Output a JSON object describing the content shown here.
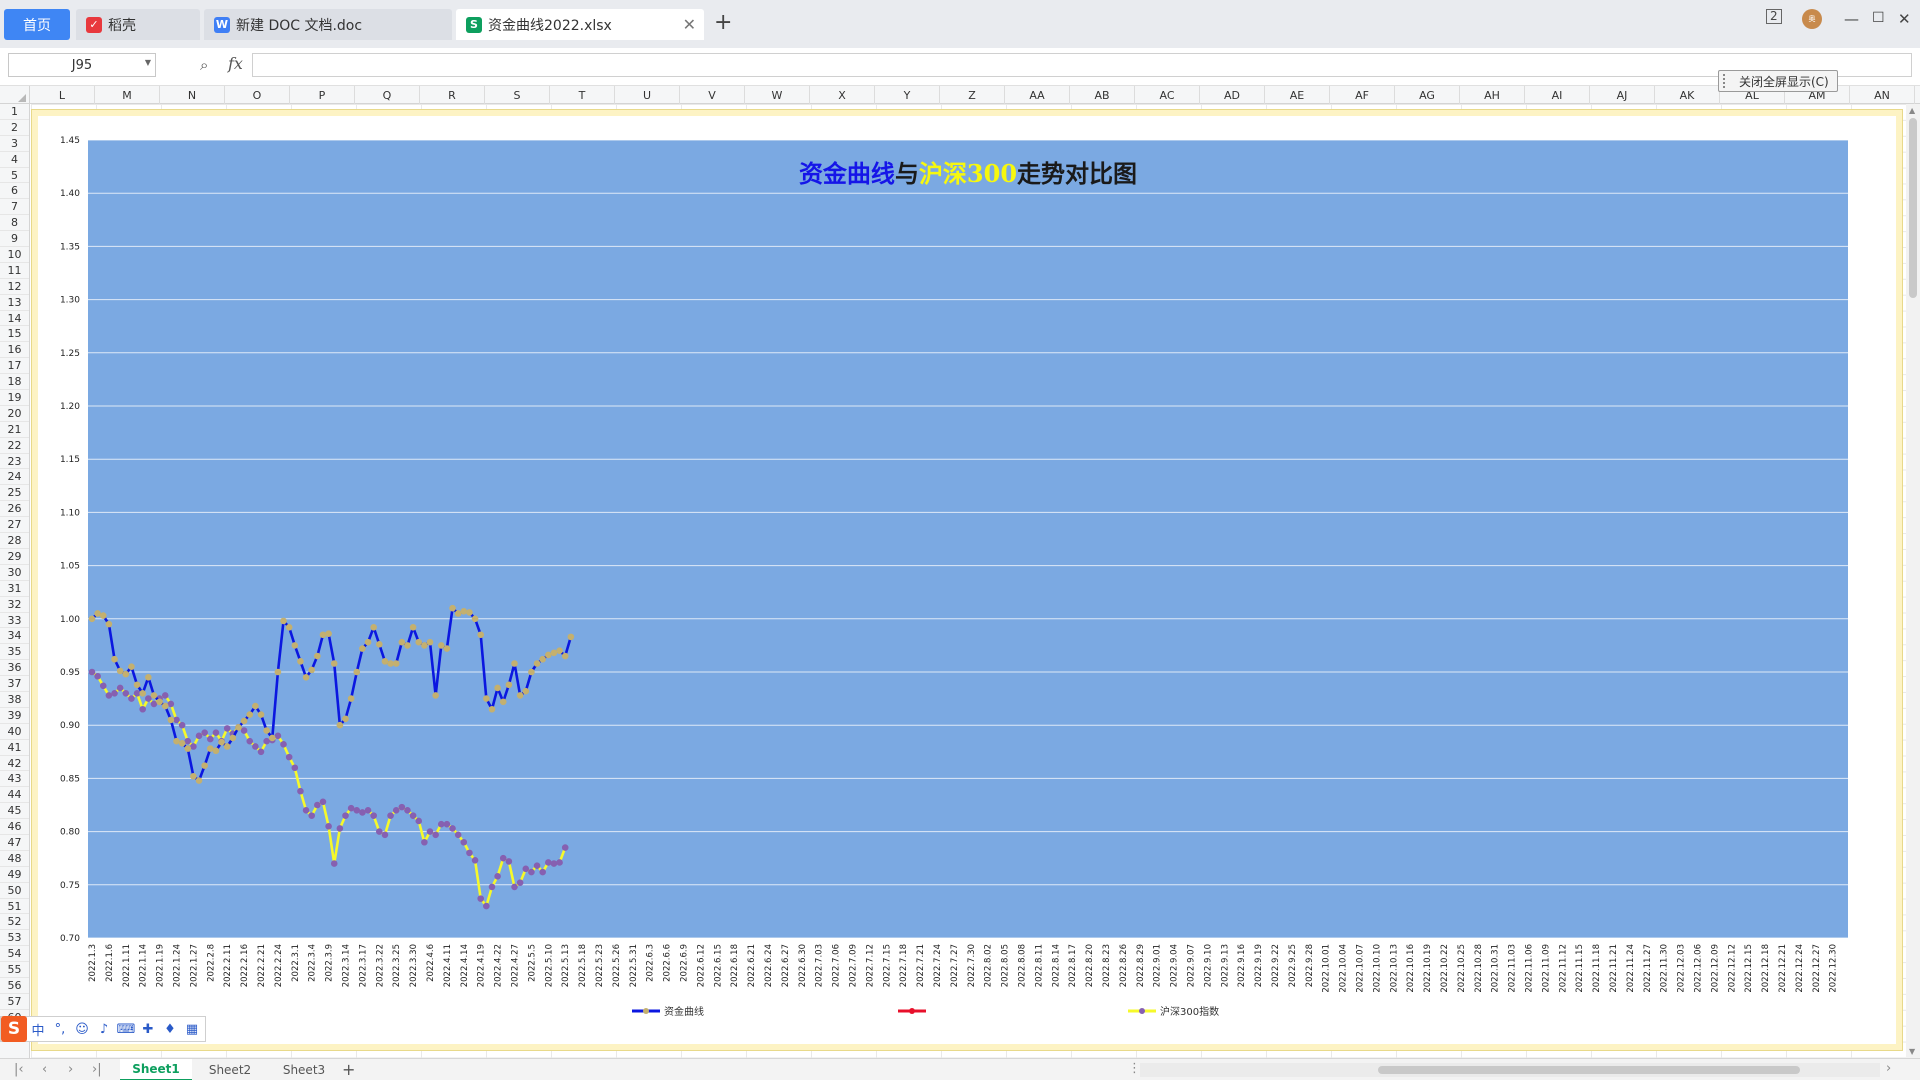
{
  "tabs": {
    "home_label": "首页",
    "docer_label": "稻壳",
    "doc_label": "新建 DOC 文档.doc",
    "xlsx_label": "资金曲线2022.xlsx"
  },
  "window": {
    "avatar_text": "奥",
    "display_mode_label": "2"
  },
  "formula_bar": {
    "cell_ref": "J95",
    "fx_label": "fx",
    "value": ""
  },
  "exit_fullscreen_label": "关闭全屏显示(C)",
  "columns": [
    "L",
    "M",
    "N",
    "O",
    "P",
    "Q",
    "R",
    "S",
    "T",
    "U",
    "V",
    "W",
    "X",
    "Y",
    "Z",
    "AA",
    "AB",
    "AC",
    "AD",
    "AE",
    "AF",
    "AG",
    "AH",
    "AI",
    "AJ",
    "AK",
    "AL",
    "AM",
    "AN"
  ],
  "rows": [
    "1",
    "2",
    "3",
    "4",
    "5",
    "6",
    "7",
    "8",
    "9",
    "10",
    "11",
    "12",
    "13",
    "14",
    "15",
    "16",
    "17",
    "18",
    "19",
    "20",
    "21",
    "22",
    "23",
    "24",
    "25",
    "26",
    "27",
    "28",
    "29",
    "30",
    "31",
    "32",
    "33",
    "34",
    "35",
    "36",
    "37",
    "38",
    "39",
    "40",
    "41",
    "42",
    "43",
    "44",
    "45",
    "46",
    "47",
    "48",
    "49",
    "50",
    "51",
    "52",
    "53",
    "54",
    "55",
    "56",
    "57",
    "60"
  ],
  "sheets": [
    "Sheet1",
    "Sheet2",
    "Sheet3"
  ],
  "colors": {
    "plot_bg": "#7ba9e2",
    "series1": "#0b17e0",
    "series2": "#e8102b",
    "series3": "#f6f92a",
    "marker1": "#c4b06f",
    "marker3": "#8660b1",
    "title_blue": "#1515e8",
    "title_yellow": "#f7f80e",
    "title_dark": "#1a1a1a"
  },
  "chart_data": {
    "type": "line",
    "title_parts": [
      "资金曲线",
      "与",
      "沪深300",
      "走势对比图"
    ],
    "ylim": [
      0.7,
      1.45
    ],
    "y_ticks": [
      0.7,
      0.75,
      0.8,
      0.85,
      0.9,
      0.95,
      1.0,
      1.05,
      1.1,
      1.15,
      1.2,
      1.25,
      1.3,
      1.35,
      1.4,
      1.45
    ],
    "grid": true,
    "legend_position": "bottom",
    "x_tick_labels": [
      "2022.1.3",
      "2022.1.6",
      "2022.1.11",
      "2022.1.14",
      "2022.1.19",
      "2022.1.24",
      "2022.1.27",
      "2022.2.8",
      "2022.2.11",
      "2022.2.16",
      "2022.2.21",
      "2022.2.24",
      "2022.3.1",
      "2022.3.4",
      "2022.3.9",
      "2022.3.14",
      "2022.3.17",
      "2022.3.22",
      "2022.3.25",
      "2022.3.30",
      "2022.4.6",
      "2022.4.11",
      "2022.4.14",
      "2022.4.19",
      "2022.4.22",
      "2022.4.27",
      "2022.5.5",
      "2022.5.10",
      "2022.5.13",
      "2022.5.18",
      "2022.5.23",
      "2022.5.26",
      "2022.5.31",
      "2022.6.3",
      "2022.6.6",
      "2022.6.9",
      "2022.6.12",
      "2022.6.15",
      "2022.6.18",
      "2022.6.21",
      "2022.6.24",
      "2022.6.27",
      "2022.6.30",
      "2022.7.03",
      "2022.7.06",
      "2022.7.09",
      "2022.7.12",
      "2022.7.15",
      "2022.7.18",
      "2022.7.21",
      "2022.7.24",
      "2022.7.27",
      "2022.7.30",
      "2022.8.02",
      "2022.8.05",
      "2022.8.08",
      "2022.8.11",
      "2022.8.14",
      "2022.8.17",
      "2022.8.20",
      "2022.8.23",
      "2022.8.26",
      "2022.8.29",
      "2022.9.01",
      "2022.9.04",
      "2022.9.07",
      "2022.9.10",
      "2022.9.13",
      "2022.9.16",
      "2022.9.19",
      "2022.9.22",
      "2022.9.25",
      "2022.9.28",
      "2022.10.01",
      "2022.10.04",
      "2022.10.07",
      "2022.10.10",
      "2022.10.13",
      "2022.10.16",
      "2022.10.19",
      "2022.10.22",
      "2022.10.25",
      "2022.10.28",
      "2022.10.31",
      "2022.11.03",
      "2022.11.06",
      "2022.11.09",
      "2022.11.12",
      "2022.11.15",
      "2022.11.18",
      "2022.11.21",
      "2022.11.24",
      "2022.11.27",
      "2022.11.30",
      "2022.12.03",
      "2022.12.06",
      "2022.12.09",
      "2022.12.12",
      "2022.12.15",
      "2022.12.18",
      "2022.12.21",
      "2022.12.24",
      "2022.12.27",
      "2022.12.30"
    ],
    "total_points": 312,
    "series": [
      {
        "name": "资金曲线",
        "values": [
          1.0,
          1.005,
          1.003,
          0.995,
          0.962,
          0.951,
          0.948,
          0.955,
          0.938,
          0.93,
          0.945,
          0.928,
          0.922,
          0.918,
          0.905,
          0.885,
          0.883,
          0.878,
          0.852,
          0.848,
          0.862,
          0.878,
          0.876,
          0.884,
          0.88,
          0.888,
          0.898,
          0.904,
          0.91,
          0.918,
          0.91,
          0.895,
          0.888,
          0.95,
          0.998,
          0.992,
          0.975,
          0.96,
          0.945,
          0.952,
          0.965,
          0.985,
          0.986,
          0.958,
          0.9,
          0.906,
          0.925,
          0.95,
          0.972,
          0.978,
          0.992,
          0.976,
          0.96,
          0.958,
          0.958,
          0.978,
          0.975,
          0.992,
          0.978,
          0.975,
          0.978,
          0.928,
          0.975,
          0.972,
          1.01,
          1.005,
          1.007,
          1.006,
          1.0,
          0.985,
          0.925,
          0.915,
          0.935,
          0.922,
          0.938,
          0.958,
          0.928,
          0.932,
          0.95,
          0.958,
          0.962,
          0.966,
          0.968,
          0.97,
          0.965,
          0.983
        ]
      },
      {
        "name": "",
        "values": []
      },
      {
        "name": "沪深300指数",
        "values": [
          0.95,
          0.946,
          0.937,
          0.928,
          0.93,
          0.935,
          0.93,
          0.925,
          0.93,
          0.915,
          0.925,
          0.92,
          0.925,
          0.928,
          0.92,
          0.905,
          0.9,
          0.885,
          0.88,
          0.89,
          0.893,
          0.887,
          0.893,
          0.885,
          0.897,
          0.892,
          0.898,
          0.895,
          0.885,
          0.88,
          0.875,
          0.885,
          0.886,
          0.89,
          0.882,
          0.87,
          0.86,
          0.838,
          0.82,
          0.815,
          0.825,
          0.828,
          0.805,
          0.77,
          0.803,
          0.815,
          0.822,
          0.82,
          0.818,
          0.82,
          0.815,
          0.8,
          0.797,
          0.815,
          0.82,
          0.823,
          0.82,
          0.815,
          0.81,
          0.79,
          0.8,
          0.797,
          0.807,
          0.807,
          0.803,
          0.797,
          0.79,
          0.78,
          0.773,
          0.737,
          0.73,
          0.748,
          0.758,
          0.775,
          0.772,
          0.748,
          0.752,
          0.765,
          0.762,
          0.768,
          0.762,
          0.771,
          0.77,
          0.771,
          0.785
        ]
      }
    ]
  }
}
